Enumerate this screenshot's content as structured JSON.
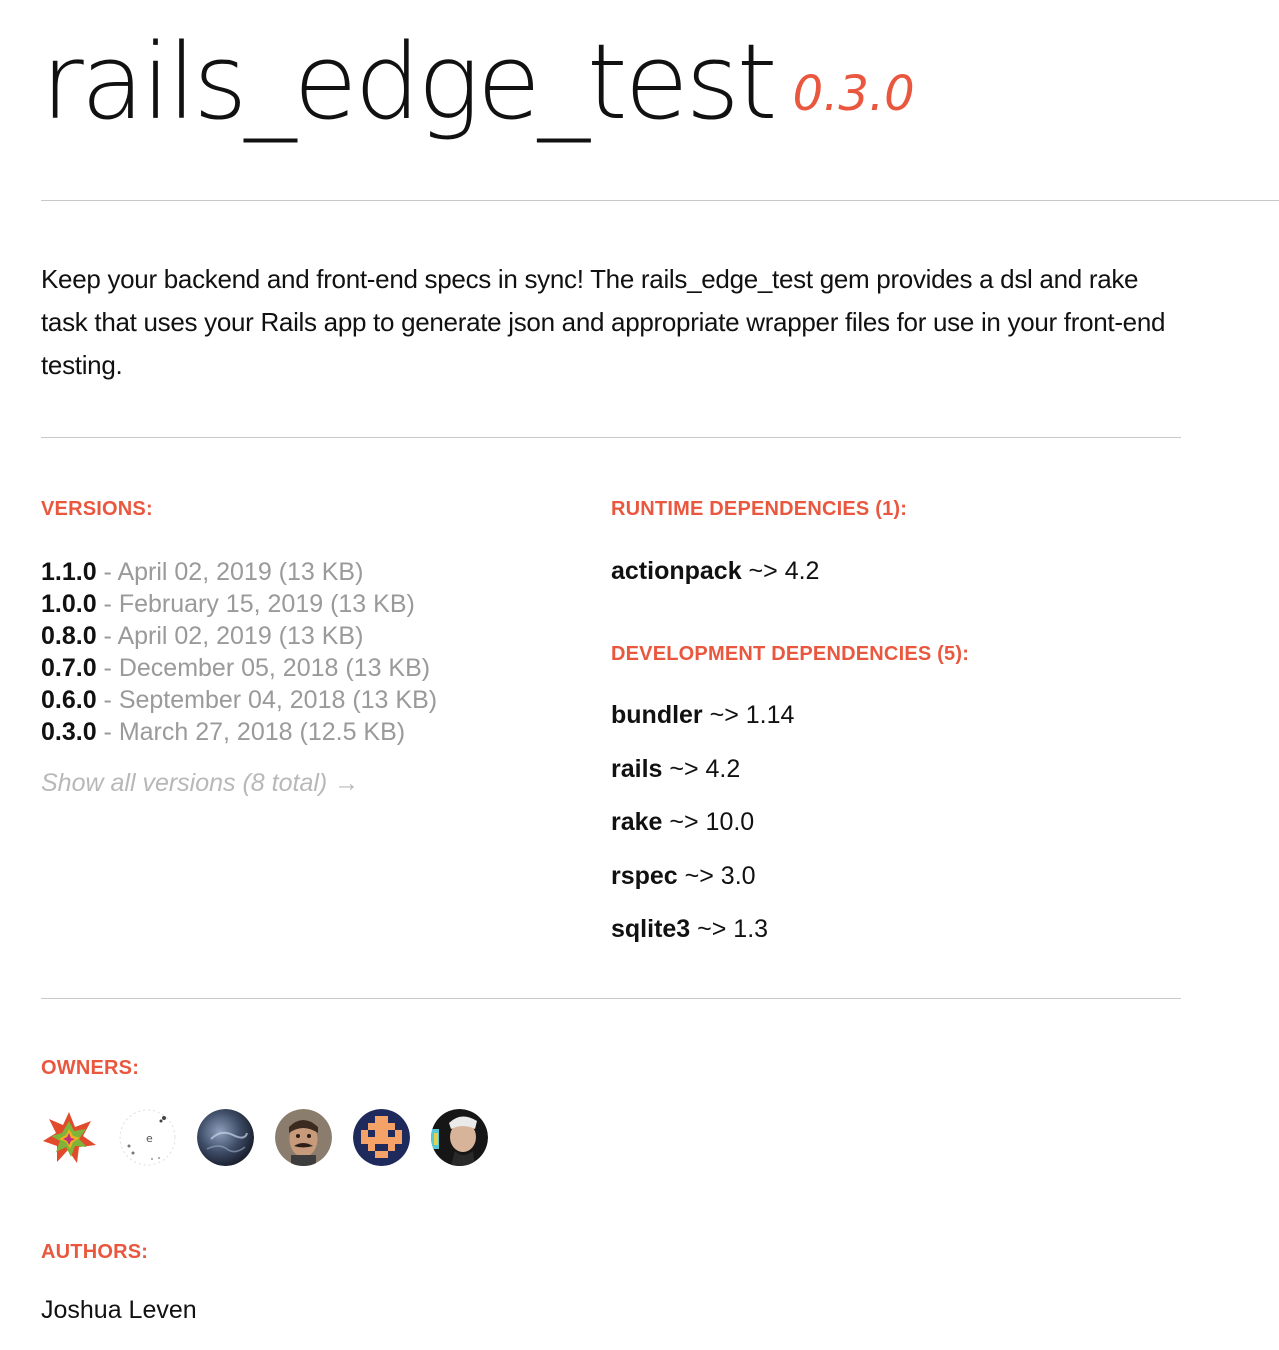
{
  "header": {
    "name": "rails_edge_test",
    "version": "0.3.0"
  },
  "description": "Keep your backend and front-end specs in sync! The rails_edge_test gem provides a dsl and rake task that uses your Rails app to generate json and appropriate wrapper files for use in your front-end testing.",
  "versions": {
    "label": "VERSIONS:",
    "items": [
      {
        "number": "1.1.0",
        "meta": " - April 02, 2019 (13 KB)"
      },
      {
        "number": "1.0.0",
        "meta": " - February 15, 2019 (13 KB)"
      },
      {
        "number": "0.8.0",
        "meta": " - April 02, 2019 (13 KB)"
      },
      {
        "number": "0.7.0",
        "meta": " - December 05, 2018 (13 KB)"
      },
      {
        "number": "0.6.0",
        "meta": " - September 04, 2018 (13 KB)"
      },
      {
        "number": "0.3.0",
        "meta": " - March 27, 2018 (12.5 KB)"
      }
    ],
    "show_all": "Show all versions (8 total) →"
  },
  "runtime": {
    "label": "RUNTIME DEPENDENCIES (1):",
    "items": [
      {
        "name": "actionpack",
        "req": " ~> 4.2"
      }
    ]
  },
  "development": {
    "label": "DEVELOPMENT DEPENDENCIES (5):",
    "items": [
      {
        "name": "bundler",
        "req": " ~> 1.14"
      },
      {
        "name": "rails",
        "req": " ~> 4.2"
      },
      {
        "name": "rake",
        "req": " ~> 10.0"
      },
      {
        "name": "rspec",
        "req": " ~> 3.0"
      },
      {
        "name": "sqlite3",
        "req": " ~> 1.3"
      }
    ]
  },
  "owners": {
    "label": "OWNERS:",
    "avatars": [
      "avatar-colorful-star",
      "avatar-white-dots",
      "avatar-dark-storm",
      "avatar-man-mustache",
      "avatar-pixel-invader",
      "avatar-man-hat"
    ]
  },
  "authors": {
    "label": "AUTHORS:",
    "name": "Joshua Leven"
  },
  "colors": {
    "accent": "#e9573f",
    "muted": "#9a9a9a",
    "rule": "#c8c8c8"
  }
}
